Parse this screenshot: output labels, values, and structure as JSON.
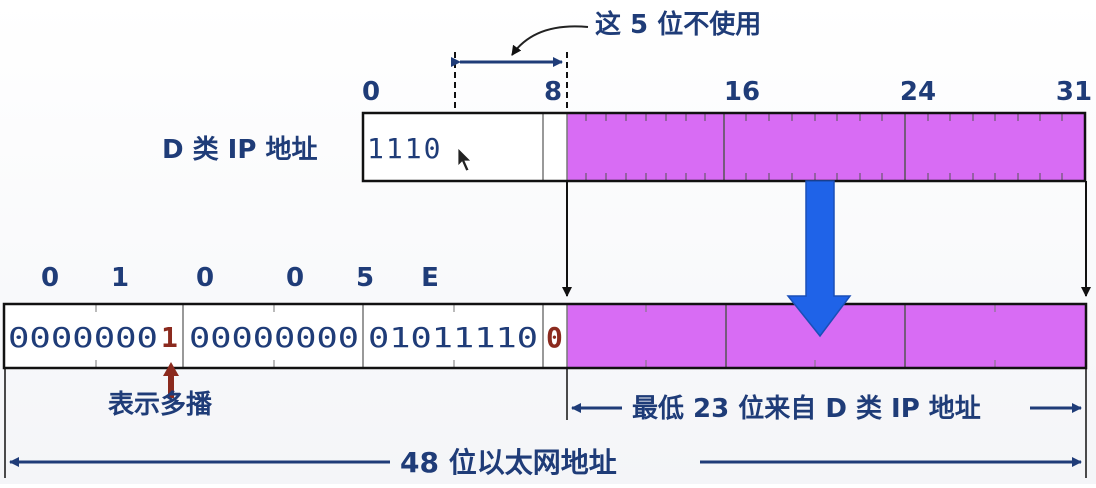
{
  "colors": {
    "text_blue": "#1f3c78",
    "accent_red": "#8b2a1e",
    "magenta": "#d86cf4",
    "arrow_blue": "#1f63e8"
  },
  "annotation_top": "这 5 位不使用",
  "d_class": {
    "label": "D 类 IP 地址",
    "bit_ticks": [
      "0",
      "8",
      "16",
      "24",
      "31"
    ],
    "prefix_bits": "1110"
  },
  "mac": {
    "hex_labels": [
      "0",
      "1",
      "0",
      "0",
      "5",
      "E"
    ],
    "byte1_a": "0000000",
    "multicast_bit": "1",
    "byte2": "00000000",
    "byte3": "01011110",
    "zero_bit": "0",
    "multicast_label": "表示多播",
    "low23_label": "最低 23 位来自 D 类 IP 地址",
    "total_label": "48 位以太网地址"
  }
}
